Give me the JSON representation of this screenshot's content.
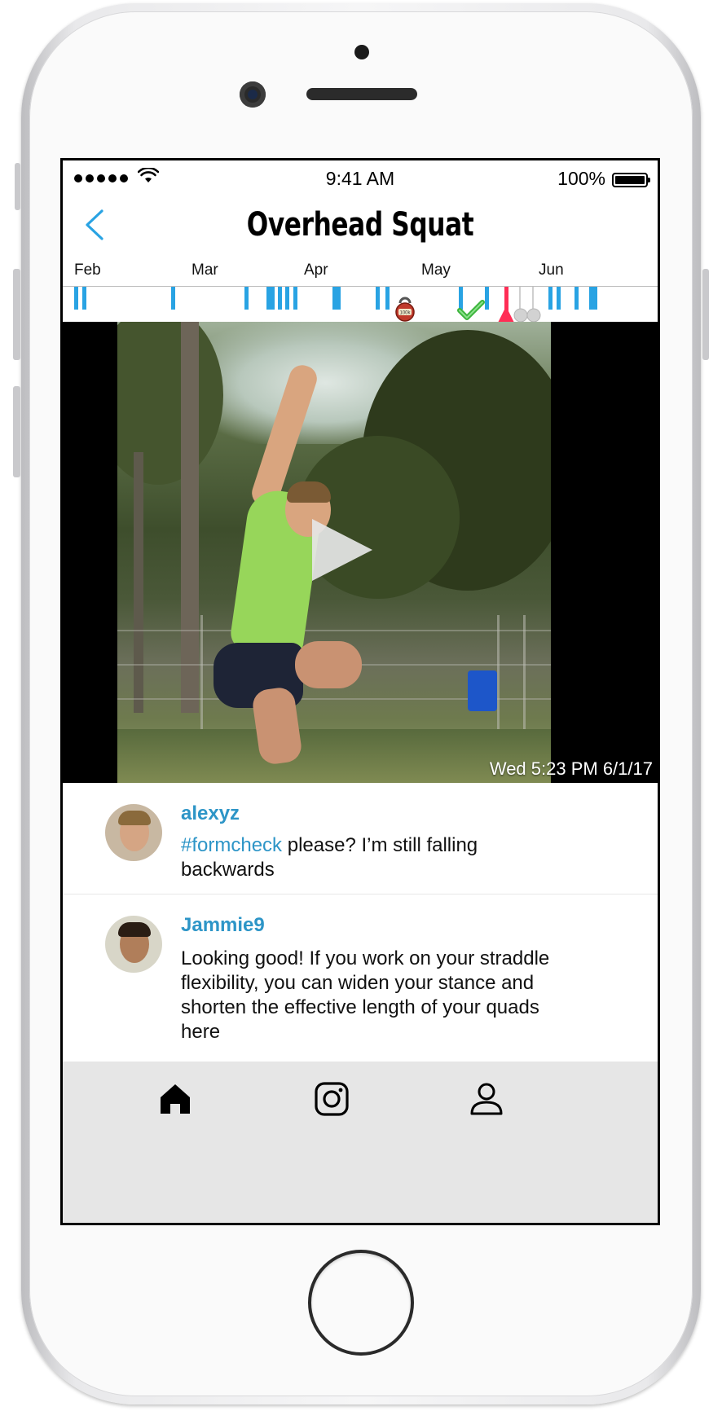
{
  "status_bar": {
    "time": "9:41 AM",
    "battery_percent": "100%"
  },
  "nav": {
    "title": "Overhead Squat",
    "back_icon": "chevron-left-icon"
  },
  "timeline": {
    "months": [
      "Feb",
      "Mar",
      "Apr",
      "May",
      "Jun"
    ],
    "markers": [
      "kettlebell-100-icon",
      "green-check-icon",
      "red-position-marker",
      "gray-circle-icon"
    ],
    "kettlebell_label": "100k"
  },
  "video": {
    "timestamp": "Wed 5:23 PM 6/1/17",
    "play_icon": "play-icon"
  },
  "comments": [
    {
      "username": "alexyz",
      "hashtag": "#formcheck",
      "text": " please? I’m still falling backwards"
    },
    {
      "username": "Jammie9",
      "text": "Looking good! If you work on your straddle flexibility, you can widen your stance and shorten the effective length of your quads here"
    }
  ],
  "tab_bar": {
    "tabs": [
      "home-icon",
      "instagram-icon",
      "profile-icon"
    ]
  },
  "colors": {
    "accent": "#29a3e3",
    "username": "#2d95c7",
    "marker_red": "#ff2d55",
    "tab_bar_bg": "#e6e6e6"
  }
}
